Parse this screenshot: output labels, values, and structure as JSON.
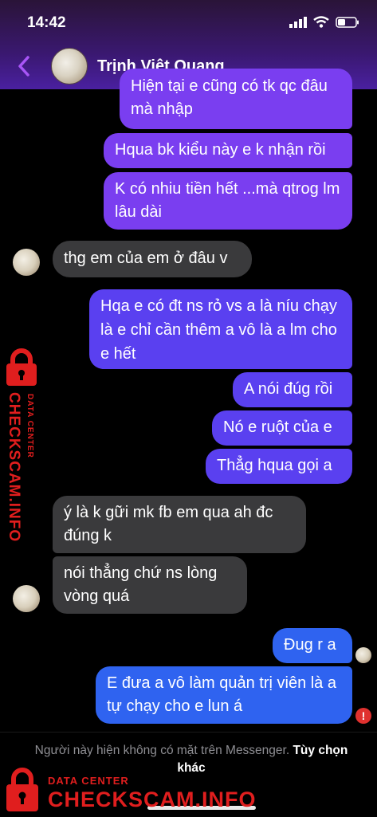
{
  "status": {
    "time": "14:42"
  },
  "header": {
    "contact_name": "Trịnh Việt Quang"
  },
  "messages": [
    {
      "dir": "out",
      "text": "Hiện tại e cũng có tk qc đâu mà nhập"
    },
    {
      "dir": "out",
      "text": "Hqua bk kiểu này e k nhận rồi"
    },
    {
      "dir": "out",
      "text": "K có nhiu tiền hết ...mà qtrog lm lâu dài"
    },
    {
      "dir": "in",
      "text": "thg em của em ở đâu v"
    },
    {
      "dir": "out",
      "text": "Hqa e có đt ns rỏ vs a là níu chạy là e chỉ cần thêm a vô là a lm cho e hết"
    },
    {
      "dir": "out",
      "text": "A nói đúg rồi"
    },
    {
      "dir": "out",
      "text": "Nó e ruột của e"
    },
    {
      "dir": "out",
      "text": "Thẳg hqua gọi a"
    },
    {
      "dir": "in",
      "text": "ý là k gữi mk fb em qua ah đc đúng k"
    },
    {
      "dir": "in",
      "text": "nói thẳng chứ ns lòng vòng quá"
    },
    {
      "dir": "out",
      "text": "Đug r a"
    },
    {
      "dir": "out",
      "text": "E đưa a vô làm quản trị viên là a tự chạy cho e lun á"
    }
  ],
  "footer": {
    "notice": "Người này hiện không có mặt trên Messenger.",
    "options_link": "Tùy chọn khác"
  },
  "watermark": {
    "line1": "DATA CENTER",
    "line2": "CHECKSCAM.INFO"
  },
  "colors": {
    "outgoing_purple": "#7a3ef0",
    "outgoing_blue": "#2f63f0",
    "incoming": "#3a3a3c",
    "watermark_red": "#e01e1e",
    "error_red": "#e0312f"
  },
  "icons": [
    "back-chevron-icon",
    "signal-icon",
    "wifi-icon",
    "battery-icon",
    "error-icon",
    "lock-icon"
  ]
}
